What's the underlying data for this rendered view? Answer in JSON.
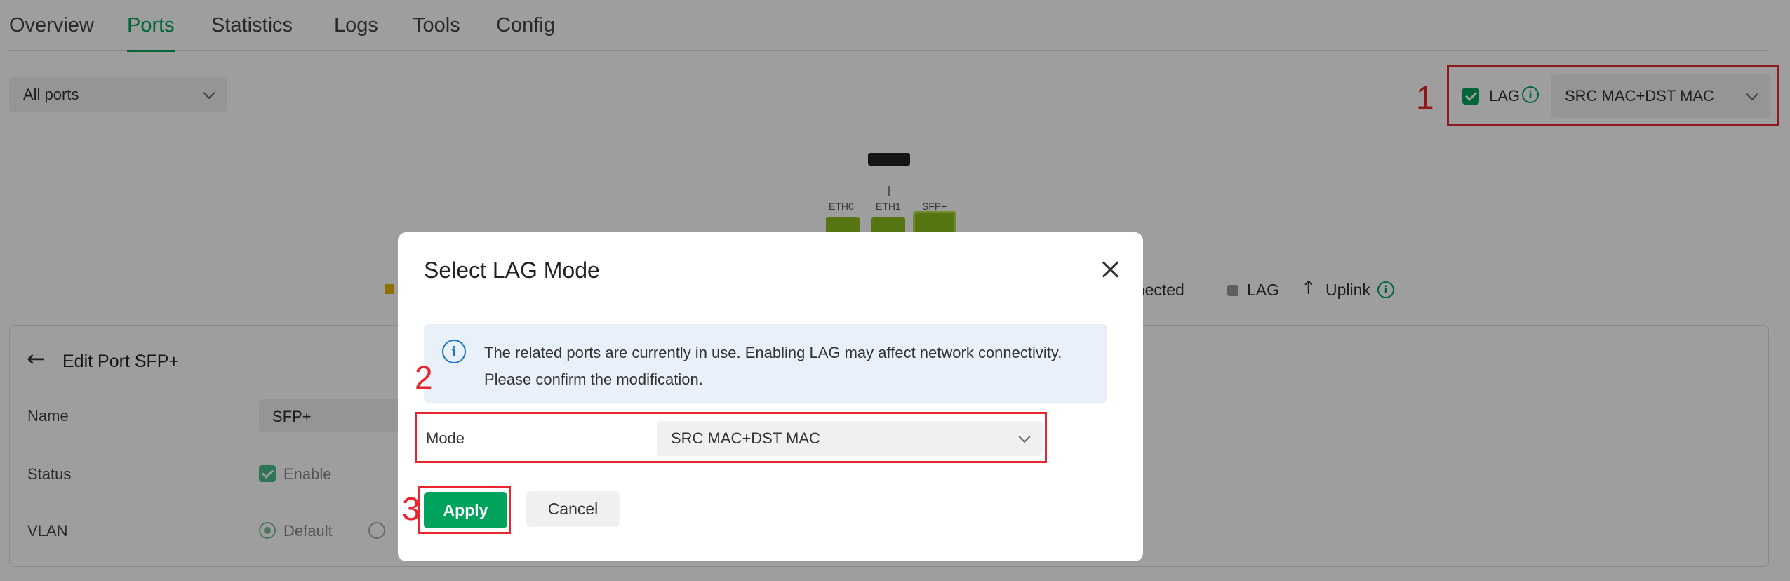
{
  "tabs": [
    {
      "label": "Overview"
    },
    {
      "label": "Ports"
    },
    {
      "label": "Statistics"
    },
    {
      "label": "Logs"
    },
    {
      "label": "Tools"
    },
    {
      "label": "Config"
    }
  ],
  "active_tab": "Ports",
  "port_filter": {
    "value": "All ports"
  },
  "lag_control": {
    "checked": true,
    "label": "LAG",
    "mode_value": "SRC MAC+DST MAC"
  },
  "ports": [
    {
      "label": "ETH0"
    },
    {
      "label": "ETH1"
    },
    {
      "label": "SFP+"
    }
  ],
  "legend": {
    "connected": "nnected",
    "lag": "LAG",
    "uplink": "Uplink"
  },
  "edit_panel": {
    "title": "Edit Port SFP+",
    "name_label": "Name",
    "name_value": "SFP+",
    "status_label": "Status",
    "status_value": "Enable",
    "vlan_label": "VLAN",
    "vlan_default": "Default"
  },
  "modal": {
    "title": "Select LAG Mode",
    "notice": "The related ports are currently in use. Enabling LAG may affect network connectivity. Please confirm the modification.",
    "mode_label": "Mode",
    "mode_value": "SRC MAC+DST MAC",
    "apply": "Apply",
    "cancel": "Cancel"
  },
  "annotations": {
    "step1": "1",
    "step2": "2",
    "step3": "3"
  },
  "colors": {
    "accent": "#00a35c",
    "annotation": "#e8262d",
    "port_active": "#8cbd1f"
  }
}
